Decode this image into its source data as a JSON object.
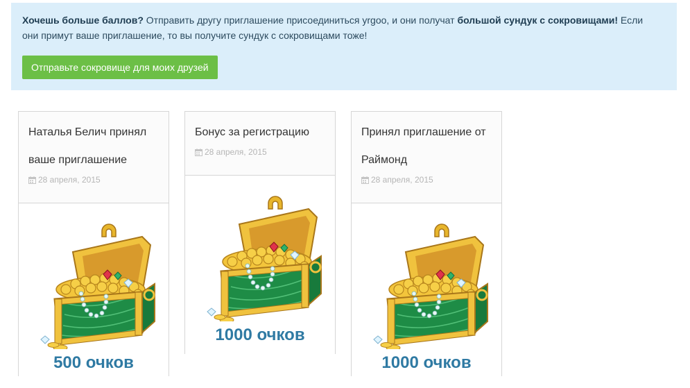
{
  "banner": {
    "bold_lead": "Хочешь больше баллов?",
    "text_a": " Отправить другу приглашение присоединиться yrgoo, и они получат ",
    "bold_chest": "большой сундук с сокровищами!",
    "text_b": " Если они примут ваше приглашение, то вы получите сундук с сокровищами тоже!",
    "button_label": "Отправьте сокровище для моих друзей"
  },
  "cards": [
    {
      "title_line1": "Наталья Белич принял",
      "title_line2": "ваше приглашение",
      "date": "28 апреля, 2015",
      "points": "500 очков",
      "icon": "calendar-icon",
      "image": "treasure-chest"
    },
    {
      "title_line1": "Бонус за регистрацию",
      "title_line2": "",
      "date": "28 апреля, 2015",
      "points": "1000 очков",
      "icon": "calendar-icon",
      "image": "treasure-chest"
    },
    {
      "title_line1": "Принял приглашение от",
      "title_line2": "Раймонд",
      "date": "28 апреля, 2015",
      "points": "1000 очков",
      "icon": "calendar-icon",
      "image": "treasure-chest"
    }
  ],
  "colors": {
    "banner_bg": "#dbeefa",
    "button_bg": "#6cbf46",
    "points_text": "#2f7aa3"
  }
}
